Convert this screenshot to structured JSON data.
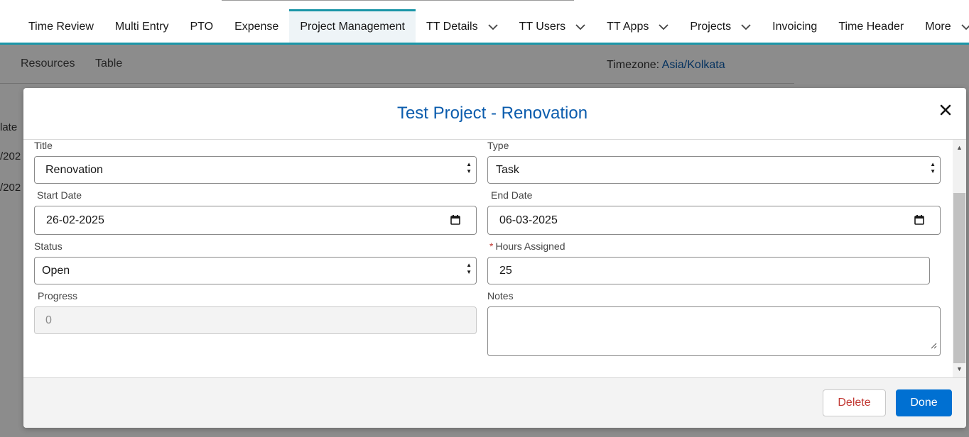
{
  "nav": {
    "tabs": [
      {
        "label": "Time Review"
      },
      {
        "label": "Multi Entry"
      },
      {
        "label": "PTO"
      },
      {
        "label": "Expense"
      },
      {
        "label": "Project Management",
        "active": true
      },
      {
        "label": "TT Details",
        "dropdown": true
      },
      {
        "label": "TT Users",
        "dropdown": true
      },
      {
        "label": "TT Apps",
        "dropdown": true
      },
      {
        "label": "Projects",
        "dropdown": true
      },
      {
        "label": "Invoicing"
      },
      {
        "label": "Time Header"
      },
      {
        "label": "More",
        "dropdown": true
      }
    ],
    "accent_color": "#1b96a8"
  },
  "subnav": {
    "resources_label": "Resources",
    "table_label": "Table",
    "timezone_label": "Timezone:",
    "timezone_value": "Asia/Kolkata"
  },
  "background": {
    "col_header": "late",
    "row1": "/202",
    "row2": "/202"
  },
  "modal": {
    "title": "Test Project - Renovation",
    "close_icon": "close-icon",
    "fields": {
      "title": {
        "label": "Title",
        "value": "Renovation"
      },
      "type": {
        "label": "Type",
        "value": "Task"
      },
      "start_date": {
        "label": "Start Date",
        "value": "26-02-2025"
      },
      "end_date": {
        "label": "End Date",
        "value": "06-03-2025"
      },
      "status": {
        "label": "Status",
        "value": "Open"
      },
      "hours_assigned": {
        "label": "Hours Assigned",
        "required_mark": "*",
        "value": "25"
      },
      "progress": {
        "label": "Progress",
        "value": "0"
      },
      "notes": {
        "label": "Notes",
        "value": ""
      }
    },
    "footer": {
      "delete_label": "Delete",
      "done_label": "Done"
    }
  },
  "colors": {
    "title_blue": "#0b5cad",
    "primary_button": "#0070d2",
    "destructive_text": "#c23934"
  }
}
